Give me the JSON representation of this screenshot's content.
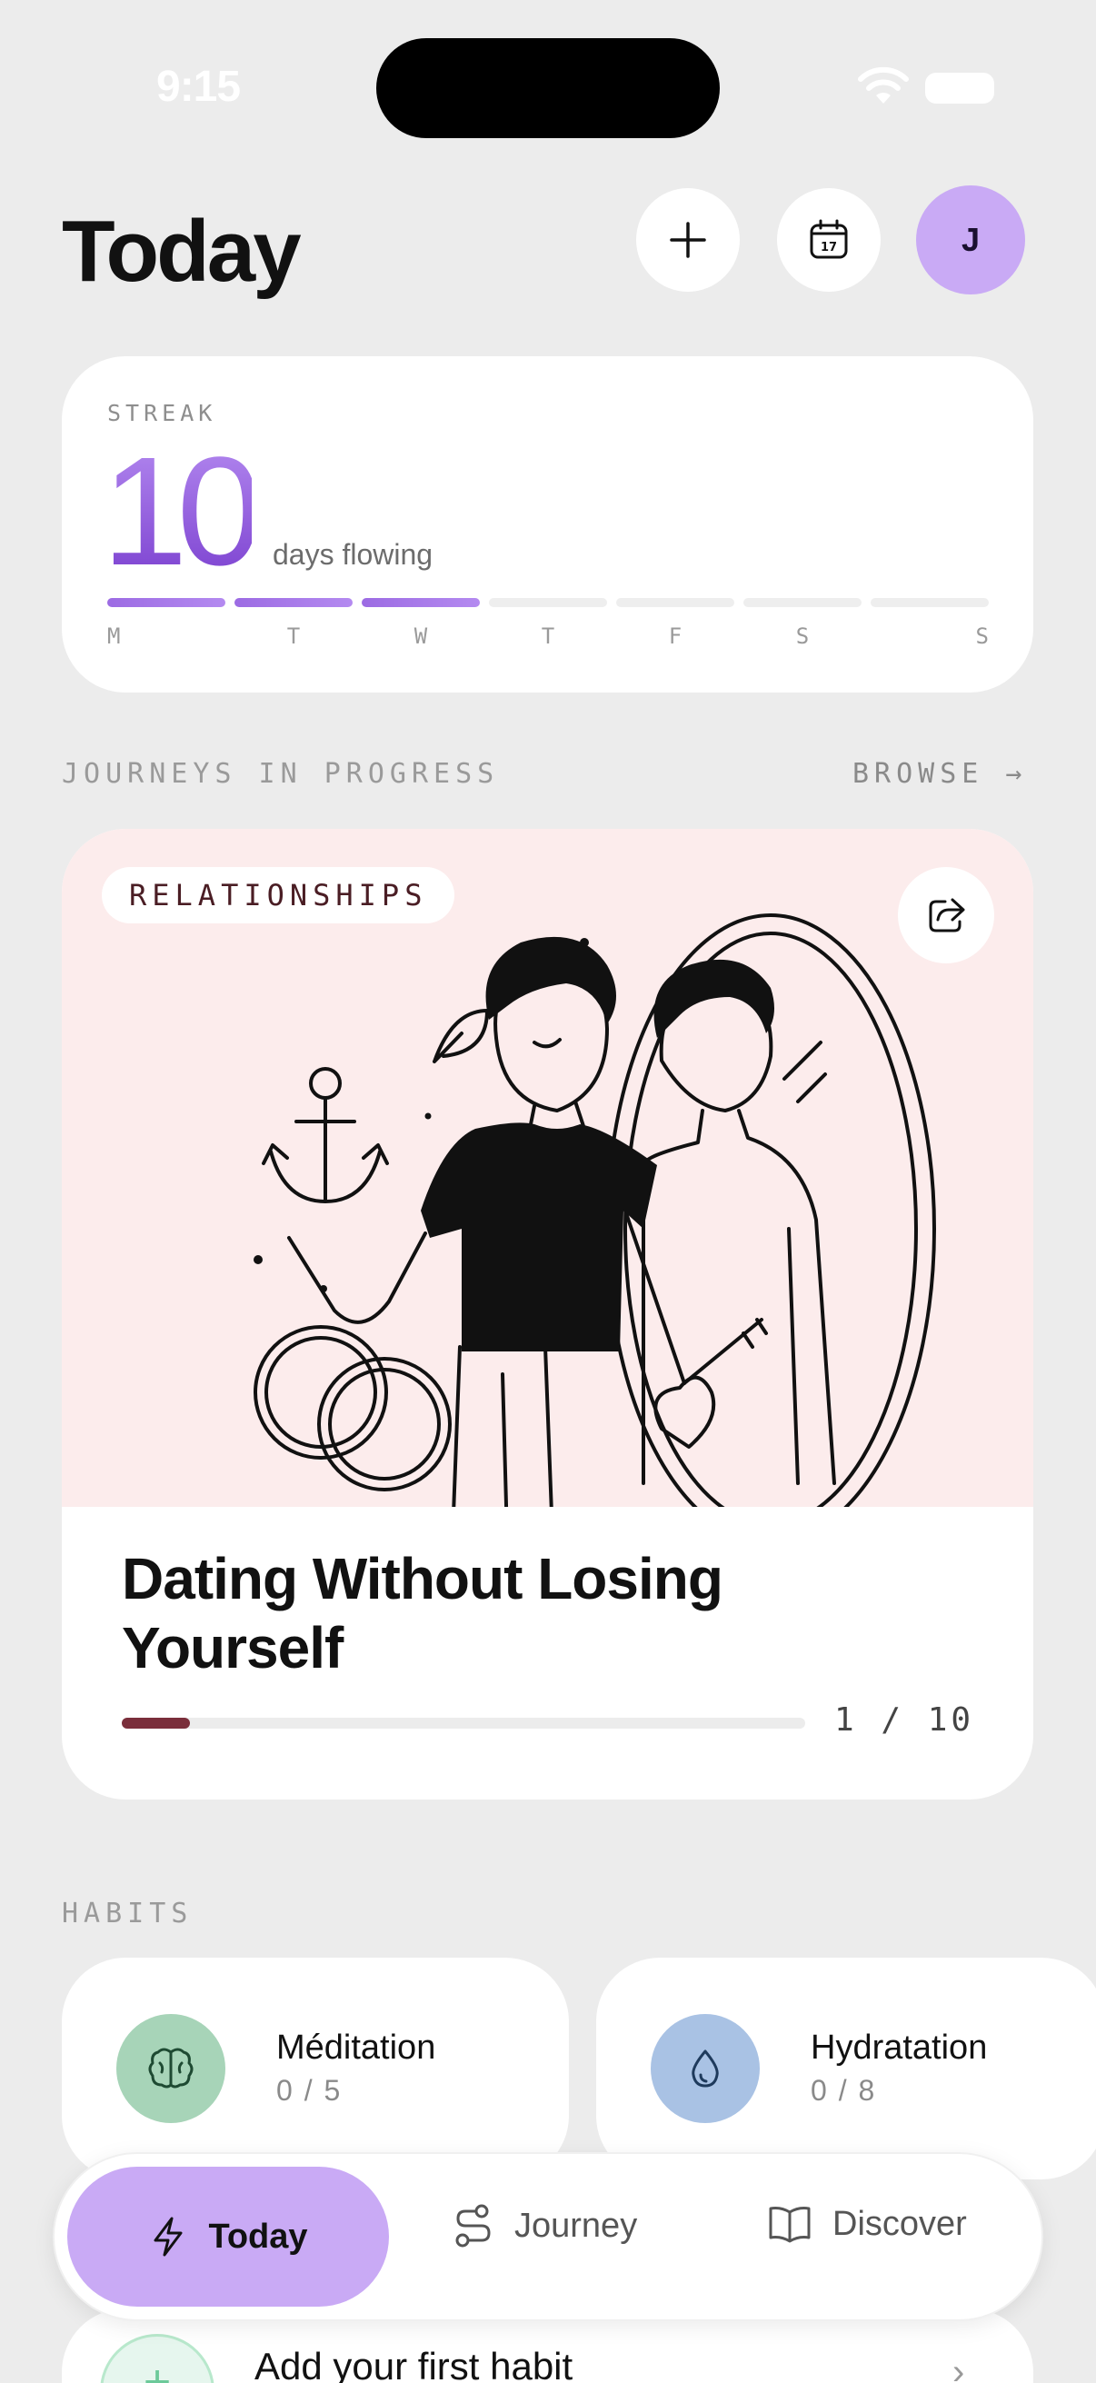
{
  "status_bar": {
    "time": "9:15"
  },
  "header": {
    "title": "Today",
    "avatar_initial": "J"
  },
  "streak": {
    "label": "STREAK",
    "count": "10",
    "unit": "days flowing",
    "days": [
      {
        "letter": "M",
        "done": true
      },
      {
        "letter": "T",
        "done": true
      },
      {
        "letter": "W",
        "done": true
      },
      {
        "letter": "T",
        "done": false
      },
      {
        "letter": "F",
        "done": false
      },
      {
        "letter": "S",
        "done": false
      },
      {
        "letter": "S",
        "done": false
      }
    ]
  },
  "journeys": {
    "section_label": "JOURNEYS IN PROGRESS",
    "browse_label": "BROWSE →",
    "current": {
      "tag": "RELATIONSHIPS",
      "title": "Dating Without Losing Yourself",
      "progress_text": "1 / 10",
      "progress_fraction": 0.1
    }
  },
  "habits": {
    "section_label": "HABITS",
    "items": [
      {
        "name": "Méditation",
        "count": "0 / 5",
        "icon": "brain-icon",
        "color": "#a7d4b8"
      },
      {
        "name": "Hydratation",
        "count": "0 / 8",
        "icon": "water-drop-icon",
        "color": "#a9c2e4"
      }
    ],
    "add_label": "Add your first habit"
  },
  "nav": {
    "items": [
      {
        "label": "Today",
        "icon": "lightning-icon",
        "active": true
      },
      {
        "label": "Journey",
        "icon": "route-icon",
        "active": false
      },
      {
        "label": "Discover",
        "icon": "book-icon",
        "active": false
      }
    ]
  },
  "colors": {
    "accent": "#c9aaf5",
    "streak": "#8b4fd6",
    "journey_bg": "#fcecec",
    "progress": "#7a2e3b"
  }
}
